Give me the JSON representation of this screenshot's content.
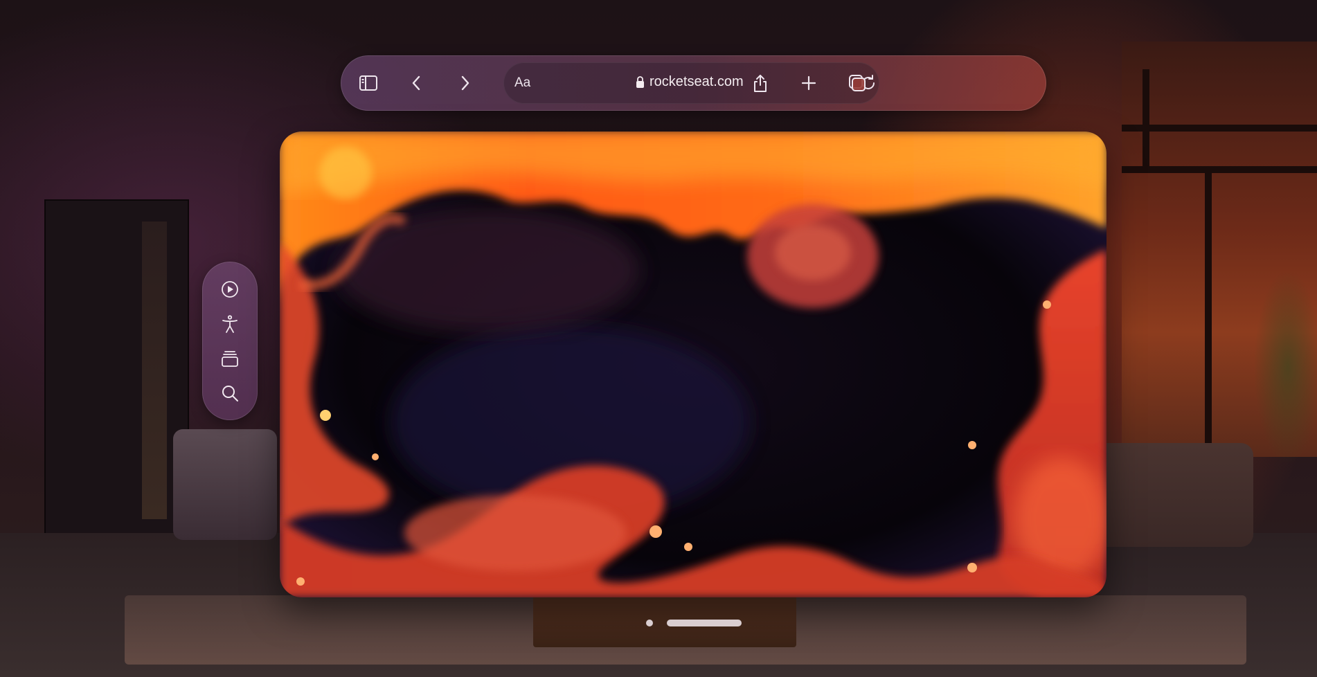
{
  "toolbar": {
    "sidebar_icon": "sidebar-icon",
    "back_icon": "chevron-left-icon",
    "forward_icon": "chevron-right-icon",
    "reader_label": "Aa",
    "url": "rocketseat.com",
    "reload_icon": "reload-icon",
    "share_icon": "share-icon",
    "new_tab_icon": "plus-icon",
    "tabs_icon": "tabs-icon"
  },
  "side_panel": {
    "items": [
      {
        "icon": "play-icon"
      },
      {
        "icon": "accessibility-icon"
      },
      {
        "icon": "stack-icon"
      },
      {
        "icon": "search-icon"
      }
    ]
  },
  "content": {
    "description_icon": "fluid-animation"
  },
  "colors": {
    "accent_orange": "#ff6a1a",
    "deep_red": "#c2311a",
    "dark": "#0a0608"
  }
}
